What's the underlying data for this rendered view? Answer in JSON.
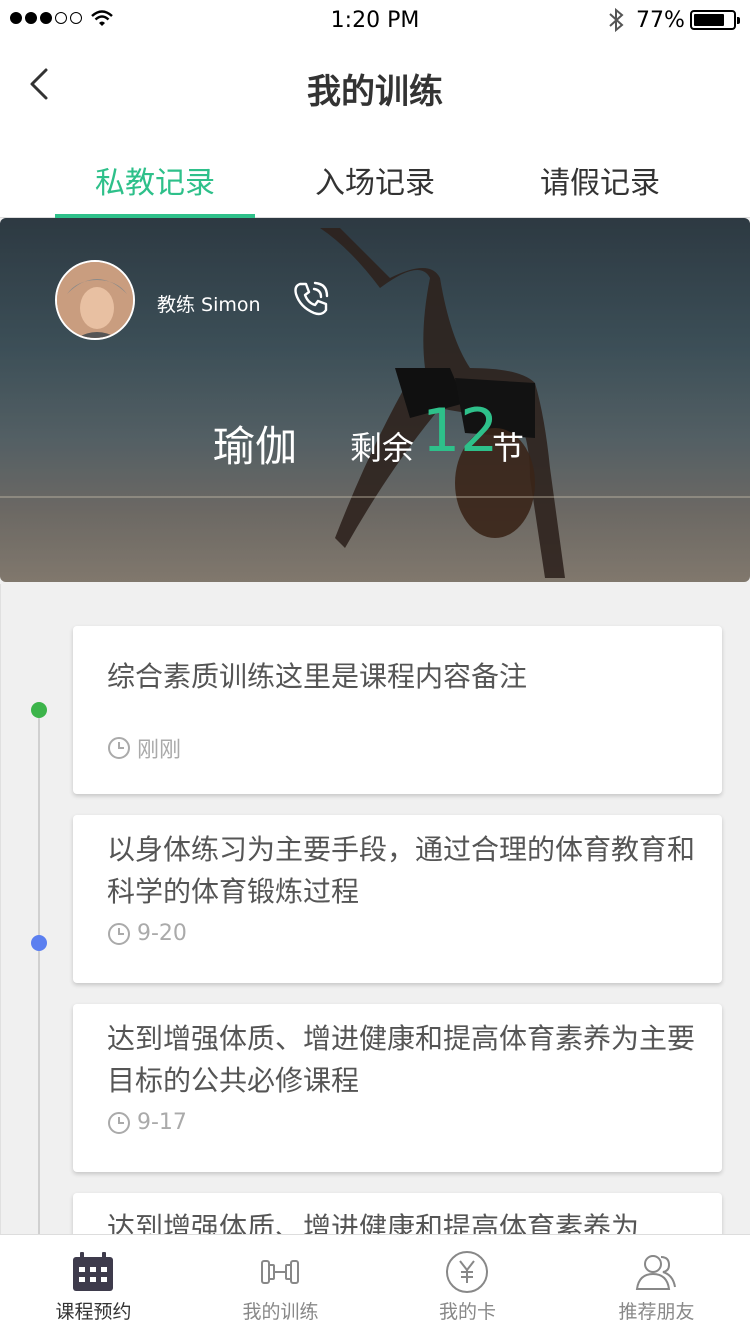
{
  "status_bar": {
    "time": "1:20 PM",
    "battery": "77%"
  },
  "nav": {
    "title": "我的训练"
  },
  "tabs": [
    {
      "label": "私教记录",
      "active": true
    },
    {
      "label": "入场记录",
      "active": false
    },
    {
      "label": "请假记录",
      "active": false
    }
  ],
  "hero": {
    "coach": "教练 Simon",
    "course": "瑜伽",
    "remain_prefix": "剩余",
    "remain_count": "12",
    "remain_unit": "节"
  },
  "records": [
    {
      "text": "综合素质训练这里是课程内容备注",
      "time": "刚刚",
      "dot_color": "#3cb44a"
    },
    {
      "text": "以身体练习为主要手段，通过合理的体育教育和科学的体育锻炼过程",
      "time": "9-20",
      "dot_color": "#5b7ff0"
    },
    {
      "text": "达到增强体质、增进健康和提高体育素养为主要目标的公共必修课程",
      "time": "9-17",
      "dot_color": ""
    },
    {
      "text": "达到增强体质、增进健康和提高体育素养为",
      "time": "",
      "dot_color": ""
    }
  ],
  "bottom_tabs": [
    {
      "label": "课程预约",
      "icon": "calendar-icon",
      "active": true
    },
    {
      "label": "我的训练",
      "icon": "dumbbell-icon",
      "active": false
    },
    {
      "label": "我的卡",
      "icon": "yuan-card-icon",
      "active": false
    },
    {
      "label": "推荐朋友",
      "icon": "friends-icon",
      "active": false
    }
  ],
  "colors": {
    "accent": "#2ec08a"
  }
}
